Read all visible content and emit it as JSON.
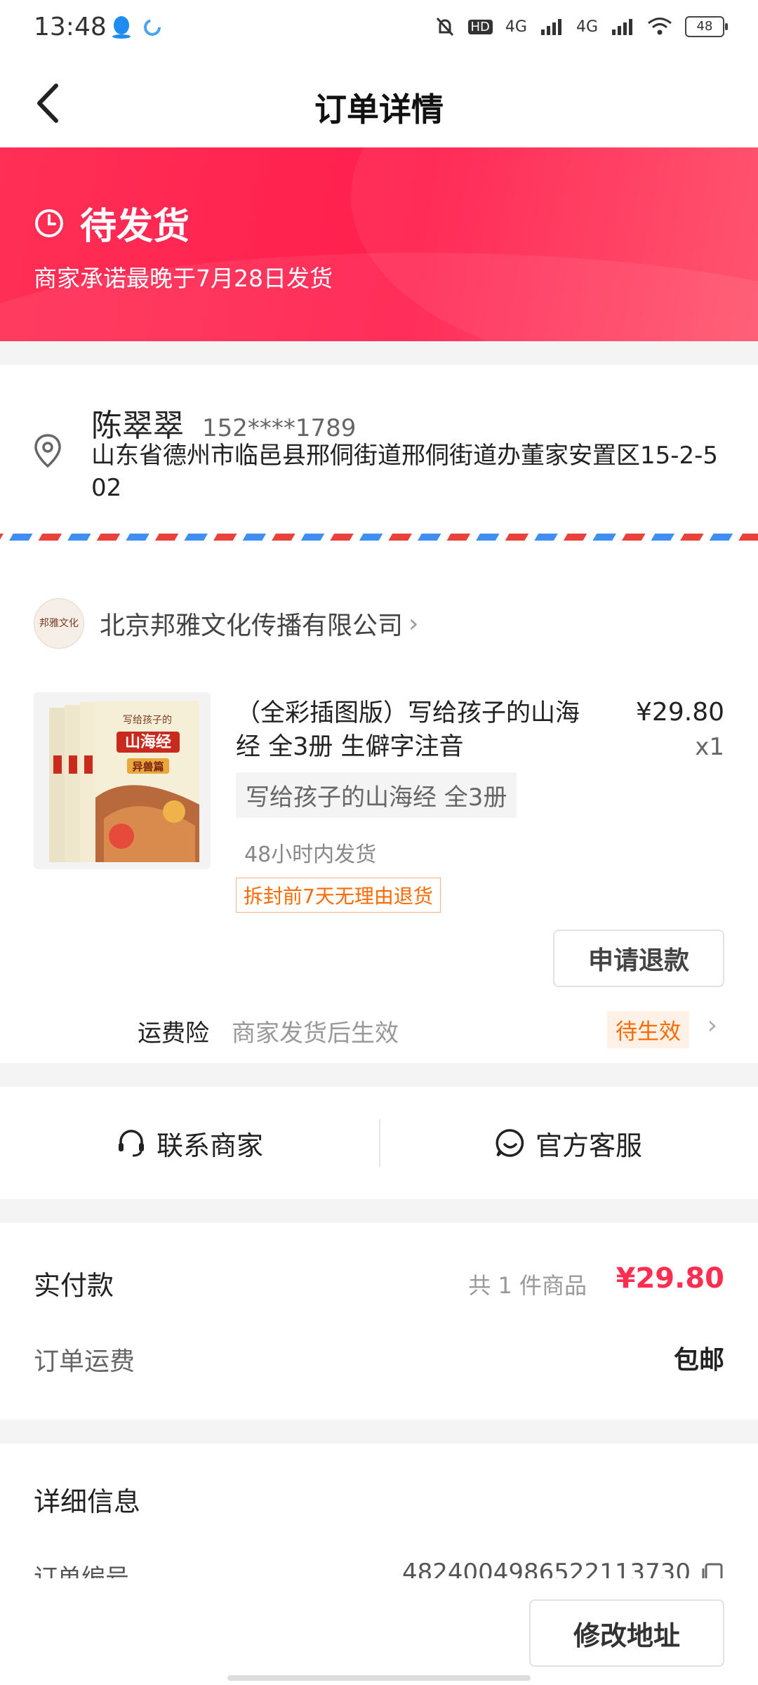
{
  "status_bar": {
    "time": "13:48",
    "network_1": "4G",
    "network_2": "4G",
    "hd_label": "HD",
    "battery": "48"
  },
  "nav": {
    "title": "订单详情"
  },
  "banner": {
    "status": "待发货",
    "subtitle": "商家承诺最晚于7月28日发货"
  },
  "address": {
    "name": "陈翠翠",
    "phone": "152****1789",
    "detail": "山东省德州市临邑县邢侗街道邢侗街道办董家安置区15-2-502"
  },
  "shop": {
    "name": "北京邦雅文化传播有限公司",
    "logo_text": "邦雅文化",
    "chevron": "›"
  },
  "product": {
    "title": "（全彩插图版）写给孩子的山海经 全3册 生僻字注音",
    "price": "¥29.80",
    "quantity": "x1",
    "sku": "写给孩子的山海经 全3册",
    "shipping": "48小时内发货",
    "return_policy": "拆封前7天无理由退货",
    "cover_title": "山海经",
    "cover_subtitle": "异兽篇",
    "cover_top": "写给孩子的"
  },
  "actions": {
    "refund": "申请退款",
    "contact_merchant": "联系商家",
    "customer_service": "官方客服",
    "modify_address": "修改地址"
  },
  "insurance": {
    "label": "运费险",
    "desc": "商家发货后生效",
    "badge": "待生效",
    "chevron": "›"
  },
  "payment": {
    "label": "实付款",
    "count": "共 1 件商品",
    "amount": "¥29.80",
    "freight_label": "订单运费",
    "freight_value": "包邮"
  },
  "details": {
    "title": "详细信息",
    "order_label": "订单编号",
    "order_number": "4824004986522113730"
  },
  "colors": {
    "accent": "#ff2d4f",
    "orange": "#ff6a00"
  }
}
